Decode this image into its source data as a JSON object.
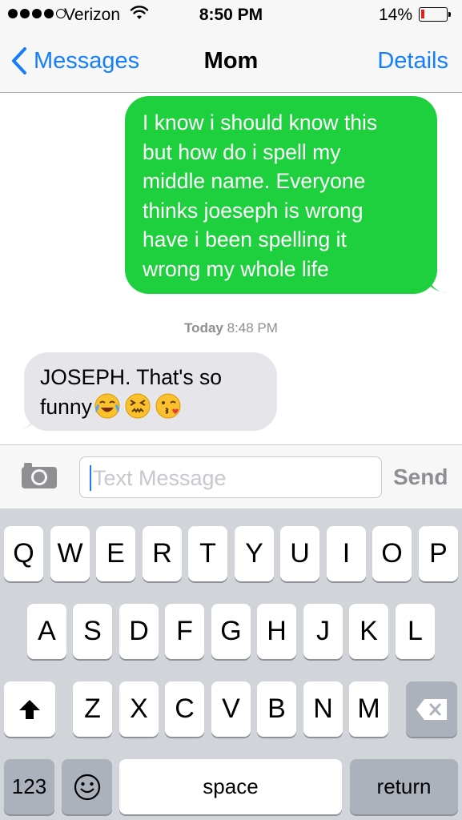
{
  "status_bar": {
    "carrier": "Verizon",
    "time": "8:50 PM",
    "battery_percent": "14%",
    "battery_level": 0.14,
    "signal_bars_filled": 4,
    "signal_bars_total": 5
  },
  "nav": {
    "back_label": "Messages",
    "title": "Mom",
    "details_label": "Details"
  },
  "conversation": {
    "outgoing_lines": [
      "I know i should know this",
      "but how do i spell my",
      "middle name. Everyone",
      "thinks joeseph is wrong",
      "have i been spelling it",
      "wrong my whole life"
    ],
    "timestamp_day": "Today",
    "timestamp_time": "8:48 PM",
    "incoming_line1": "JOSEPH. That's so",
    "incoming_line2": "funny",
    "incoming_emojis": [
      "face-with-tears-of-joy-emoji",
      "confounded-face-emoji",
      "face-throwing-kiss-emoji"
    ]
  },
  "composer": {
    "placeholder": "Text Message",
    "send_label": "Send"
  },
  "keyboard": {
    "row1": [
      "Q",
      "W",
      "E",
      "R",
      "T",
      "Y",
      "U",
      "I",
      "O",
      "P"
    ],
    "row2": [
      "A",
      "S",
      "D",
      "F",
      "G",
      "H",
      "J",
      "K",
      "L"
    ],
    "row3": [
      "Z",
      "X",
      "C",
      "V",
      "B",
      "N",
      "M"
    ],
    "numbers_label": "123",
    "space_label": "space",
    "return_label": "return"
  },
  "colors": {
    "accent": "#157efb",
    "outgoing_bubble": "#1ed03e",
    "incoming_bubble": "#e5e5ea",
    "battery_low": "#e0201d",
    "keyboard_bg": "#d1d4d9"
  }
}
